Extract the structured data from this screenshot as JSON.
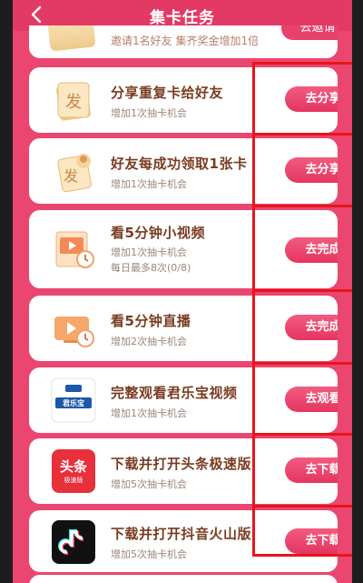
{
  "header": {
    "title": "集卡任务",
    "back_icon": "chevron-left-icon"
  },
  "top_task": {
    "subtitle": "邀请1名好友 集齐奖金增加1倍",
    "button": "去邀请"
  },
  "tasks": [
    {
      "title": "分享重复卡给好友",
      "sub1": "增加1次抽卡机会",
      "sub2": "",
      "button": "去分享",
      "icon": "share-card-icon"
    },
    {
      "title": "好友每成功领取1张卡",
      "sub1": "增加1次抽卡机会",
      "sub2": "",
      "button": "去分享",
      "icon": "friend-card-icon"
    },
    {
      "title": "看5分钟小视频",
      "sub1": "增加1次抽卡机会",
      "sub2": "每日最多8次(0/8)",
      "button": "去完成",
      "icon": "video-icon"
    },
    {
      "title": "看5分钟直播",
      "sub1": "增加2次抽卡机会",
      "sub2": "",
      "button": "去完成",
      "icon": "live-icon"
    },
    {
      "title": "完整观看君乐宝视频",
      "sub1": "增加1次抽卡机会",
      "sub2": "",
      "button": "去观看",
      "icon": "junlebao-logo-icon",
      "logo_text": "君乐宝"
    },
    {
      "title": "下载并打开头条极速版",
      "sub1": "增加5次抽卡机会",
      "sub2": "",
      "button": "去下载",
      "icon": "toutiao-logo-icon",
      "logo_text": "头条",
      "logo_sub": "极速版"
    },
    {
      "title": "下载并打开抖音火山版",
      "sub1": "增加5次抽卡机会",
      "sub2": "",
      "button": "去下载",
      "icon": "douyin-logo-icon"
    }
  ],
  "colors": {
    "background": "#ea4670",
    "button": "#e53561",
    "title": "#7a3b21",
    "highlight": "#e8151b"
  }
}
